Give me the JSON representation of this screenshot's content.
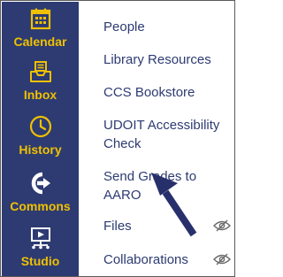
{
  "global_nav": {
    "items": [
      {
        "label": "Calendar",
        "icon": "calendar-icon"
      },
      {
        "label": "Inbox",
        "icon": "inbox-icon"
      },
      {
        "label": "History",
        "icon": "history-icon"
      },
      {
        "label": "Commons",
        "icon": "commons-icon"
      },
      {
        "label": "Studio",
        "icon": "studio-icon"
      }
    ]
  },
  "course_nav": {
    "items": [
      {
        "label": "People"
      },
      {
        "label": "Library Resources"
      },
      {
        "label": "CCS Bookstore"
      },
      {
        "label_line1": "UDOIT Accessibility",
        "label_line2": "Check"
      },
      {
        "label_line1": "Send Grades to",
        "label_line2": "AARO"
      },
      {
        "label": "Files",
        "visibility_icon": "eye-slash-icon"
      },
      {
        "label": "Collaborations",
        "visibility_icon": "eye-slash-icon"
      }
    ]
  },
  "annotation": {
    "icon": "pointer-arrow-icon"
  },
  "colors": {
    "rail_background": "#2d3b72",
    "rail_text": "#f0c000",
    "link_text": "#2d3b72",
    "eye_icon": "#6b6b6b",
    "arrow": "#28306b"
  }
}
